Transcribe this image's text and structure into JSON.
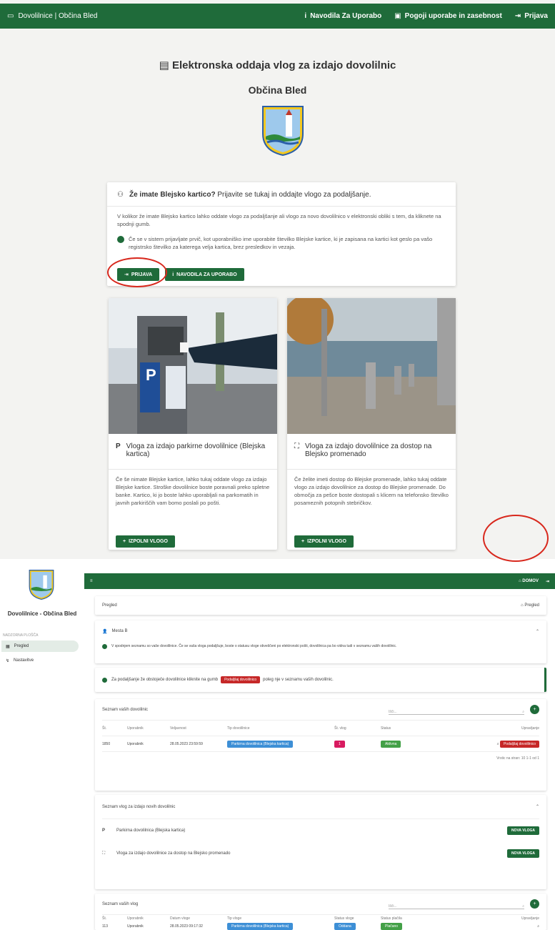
{
  "top": {
    "brand": "Dovolilnice | Občina Bled",
    "nav": [
      {
        "icon": "info-icon",
        "label": "Navodila Za Uporabo"
      },
      {
        "icon": "lock-icon",
        "label": "Pogoji uporabe in zasebnost"
      },
      {
        "icon": "login-icon",
        "label": "Prijava"
      }
    ],
    "title": "Elektronska oddaja vlog za izdajo dovolilnic",
    "subtitle": "Občina Bled",
    "login_card": {
      "heading_bold": "Že imate Blejsko kartico?",
      "heading_rest": " Prijavite se tukaj in oddajte vlogo za podaljšanje.",
      "body": "V kolikor že imate Blejsko kartico lahko oddate vlogo za podaljšanje ali vlogo za novo dovolilnico v elektronski obliki s tem, da kliknete na spodnji gumb.",
      "note": "Če se v sistem prijavljate prvič, kot uporabniško ime uporabite številko Blejske kartice, ki je zapisana na kartici kot geslo pa vašo registrsko številko za katerega velja kartica, brez presledkov in vezaja.",
      "btn_login": "PRIJAVA",
      "btn_manual": "NAVODILA ZA UPORABO"
    },
    "tiles": [
      {
        "icon": "parking-icon",
        "title": "Vloga za izdajo parkirne dovolilnice (Blejska kartica)",
        "body": "Če še nimate Blejske kartice, lahko tukaj oddate vlogo za izdajo Blejske kartice. Stroške dovolilnice boste poravnali preko spletne banke. Kartico, ki jo boste lahko uporabljali na parkomatih in javnih parkiriščih vam bomo poslali po pošti.",
        "btn": "IZPOLNI VLOGO"
      },
      {
        "icon": "walk-icon",
        "title": "Vloga za izdajo dovolilnice za dostop na Blejsko promenado",
        "body": "Če želite imeti dostop do Blejske promenade, lahko tukaj oddate vlogo za izdajo dovolilnice za dostop do Blejske promenade. Do območja za pešce boste dostopali s klicem na telefonsko številko posameznih potopnih stebričkov.",
        "btn": "IZPOLNI VLOGO"
      }
    ]
  },
  "bottom": {
    "brand": "Dovolilnice - Občina Bled",
    "caption": "NADZORNA PLOŠČA",
    "side_items": [
      "Pregled",
      "Nastavitve"
    ],
    "bar_right": [
      "DOMOV"
    ],
    "panel_title": "Pregled",
    "panel_action": "Pregled",
    "user_name": "Mesta B",
    "info_text": "V spodnjem seznamu so vaše dovolilnice. Če se vaša vloga podaljšuje, boste o statusu vloge obveščeni po elektronski pošti, dovolilnica pa bo vidna tudi v seznamu vaših dovolilnic.",
    "warn_text": "Za podaljšanje že obstoječe dovolilnice kliknite na gumb",
    "warn_btn": "Podaljšaj dovolilnico",
    "warn_rest": "poleg nje v seznamu vaših dovolilnic.",
    "perm_title": "Seznam vaših dovolilnic",
    "search": "Išči...",
    "perm_headers": [
      "Št.",
      "Uporabnik",
      "Veljavnost",
      "Tip dovolilnice",
      "Št. vlog",
      "Status",
      "Upravljanje"
    ],
    "perm_row": [
      "1850",
      "Uporabnik",
      "28.05.2023 23:59:59",
      "Parkirna dovolilnica (Blejska kartica)",
      "1",
      "Aktivna",
      "Podaljšaj dovolilnico"
    ],
    "pager": "Vrstic na stran:  10   1-1 od 1",
    "apps_title": "Seznam vlog za izdajo novih dovolilnic",
    "apps": [
      {
        "icon": "parking-icon",
        "label": "Parkirna dovolilnica (Blejska kartica)",
        "btn": "NOVA VLOGA"
      },
      {
        "icon": "walk-icon",
        "label": "Vloga za izdajo dovolilnice za dostop na Blejsko promenado",
        "btn": "NOVA VLOGA"
      }
    ],
    "list_title": "Seznam vaših vlog",
    "list_headers": [
      "Št.",
      "Uporabnik",
      "Datum vloge",
      "Tip vloge",
      "Status vloge",
      "Status plačila",
      "Upravljanje"
    ],
    "list_row": [
      "113",
      "Uporabnik",
      "28.05.2023 09:17:32",
      "Parkirna dovolilnica (Blejska kartica)",
      "Oddana",
      "Plačano",
      ""
    ]
  },
  "colors": {
    "brand_green": "#1f6b3a",
    "accent_red": "#c62828",
    "chip_blue": "#3d8fd6",
    "chip_pink": "#d81b60"
  }
}
